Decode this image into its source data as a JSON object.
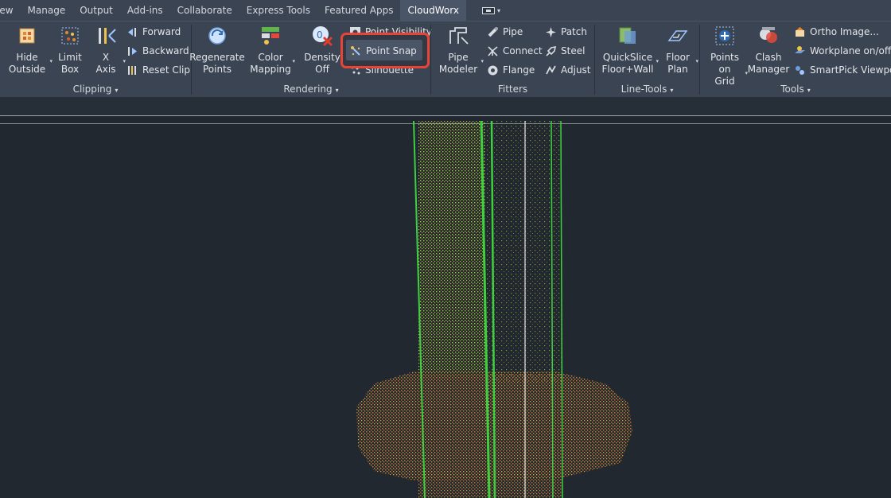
{
  "tabs": [
    {
      "label": "View",
      "display": "iew"
    },
    {
      "label": "Manage"
    },
    {
      "label": "Output"
    },
    {
      "label": "Add-ins"
    },
    {
      "label": "Collaborate"
    },
    {
      "label": "Express Tools"
    },
    {
      "label": "Featured Apps"
    },
    {
      "label": "CloudWorx",
      "active": true
    }
  ],
  "panels": {
    "clipping": {
      "title": "Clipping",
      "hide_outside": "Hide\nOutside",
      "limit_box": "Limit\nBox",
      "x_axis": "X\nAxis",
      "forward": "Forward",
      "backward": "Backward",
      "reset_clip": "Reset Clip"
    },
    "rendering": {
      "title": "Rendering",
      "regenerate_points": "Regenerate\nPoints",
      "color_mapping": "Color\nMapping",
      "density_off": "Density\nOff",
      "point_visibility": "Point Visibility",
      "point_snap": "Point Snap",
      "silhouette": "Silhouette"
    },
    "fitters": {
      "title": "Fitters",
      "pipe_modeler": "Pipe\nModeler",
      "pipe": "Pipe",
      "connect": "Connect",
      "flange": "Flange",
      "patch": "Patch",
      "steel": "Steel",
      "adjust": "Adjust"
    },
    "line_tools": {
      "title": "Line-Tools",
      "quickslice": "QuickSlice\nFloor+Wall",
      "floor_plan": "Floor\nPlan"
    },
    "tools": {
      "title": "Tools",
      "points_on_grid": "Points\non Grid",
      "clash_manager": "Clash\nManager",
      "ortho_image": "Ortho Image...",
      "workplane": "Workplane on/off",
      "smartpick": "SmartPick Viewport"
    }
  },
  "colors": {
    "ribbon_bg": "#3b4453",
    "viewport_bg": "#212830",
    "highlight": "#ea4335",
    "fit_line": "#3ed13e",
    "point_green": "#a6cf3a",
    "point_orange": "#d8752e"
  }
}
